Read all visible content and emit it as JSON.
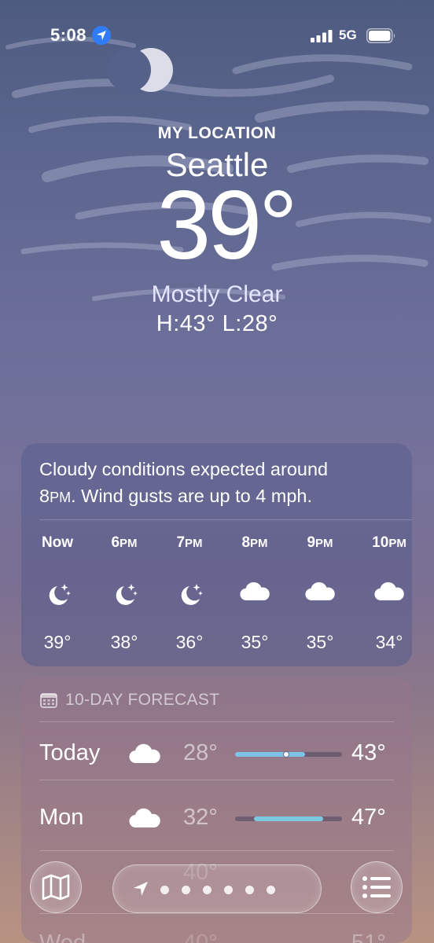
{
  "status_bar": {
    "time": "5:08",
    "network": "5G",
    "location_icon": "location-arrow-icon",
    "signal_icon": "cellular-signal-icon",
    "battery_icon": "battery-icon"
  },
  "location": {
    "header": "MY LOCATION",
    "city": "Seattle",
    "temperature": "39°",
    "condition": "Mostly Clear",
    "high_low": "H:43°  L:28°"
  },
  "hourly": {
    "summary_line1": "Cloudy conditions expected around",
    "summary_line2_time": "8",
    "summary_line2_ampm": "PM",
    "summary_line2_rest": ". Wind gusts are up to 4 mph.",
    "items": [
      {
        "hour": "Now",
        "suffix": "",
        "icon": "moon-stars-icon",
        "temp": "39°"
      },
      {
        "hour": "6",
        "suffix": "PM",
        "icon": "moon-stars-icon",
        "temp": "38°"
      },
      {
        "hour": "7",
        "suffix": "PM",
        "icon": "moon-stars-icon",
        "temp": "36°"
      },
      {
        "hour": "8",
        "suffix": "PM",
        "icon": "cloud-icon",
        "temp": "35°"
      },
      {
        "hour": "9",
        "suffix": "PM",
        "icon": "cloud-icon",
        "temp": "35°"
      },
      {
        "hour": "10",
        "suffix": "PM",
        "icon": "cloud-icon",
        "temp": "34°"
      }
    ]
  },
  "forecast": {
    "header": "10-DAY FORECAST",
    "header_icon": "calendar-icon",
    "range_low": 28,
    "range_high": 51,
    "days": [
      {
        "day": "Today",
        "icon": "cloud-icon",
        "low": "28°",
        "high": "43°",
        "low_value": 28,
        "high_value": 43,
        "current_value": 39,
        "bar_color": "#7cc4ea"
      },
      {
        "day": "Mon",
        "icon": "cloud-icon",
        "low": "32°",
        "high": "47°",
        "low_value": 32,
        "high_value": 47,
        "bar_color": "#7bc8e0"
      }
    ],
    "partial_day": "Wed",
    "partial_low": "40°",
    "partial_high": "51°"
  },
  "toolbar": {
    "map_icon": "map-icon",
    "nav_icon": "location-arrow-icon",
    "list_icon": "list-icon",
    "page_dots": 6
  },
  "colors": {
    "location_blue": "#2f7cf6",
    "condition_text": "#e4e6ff"
  }
}
